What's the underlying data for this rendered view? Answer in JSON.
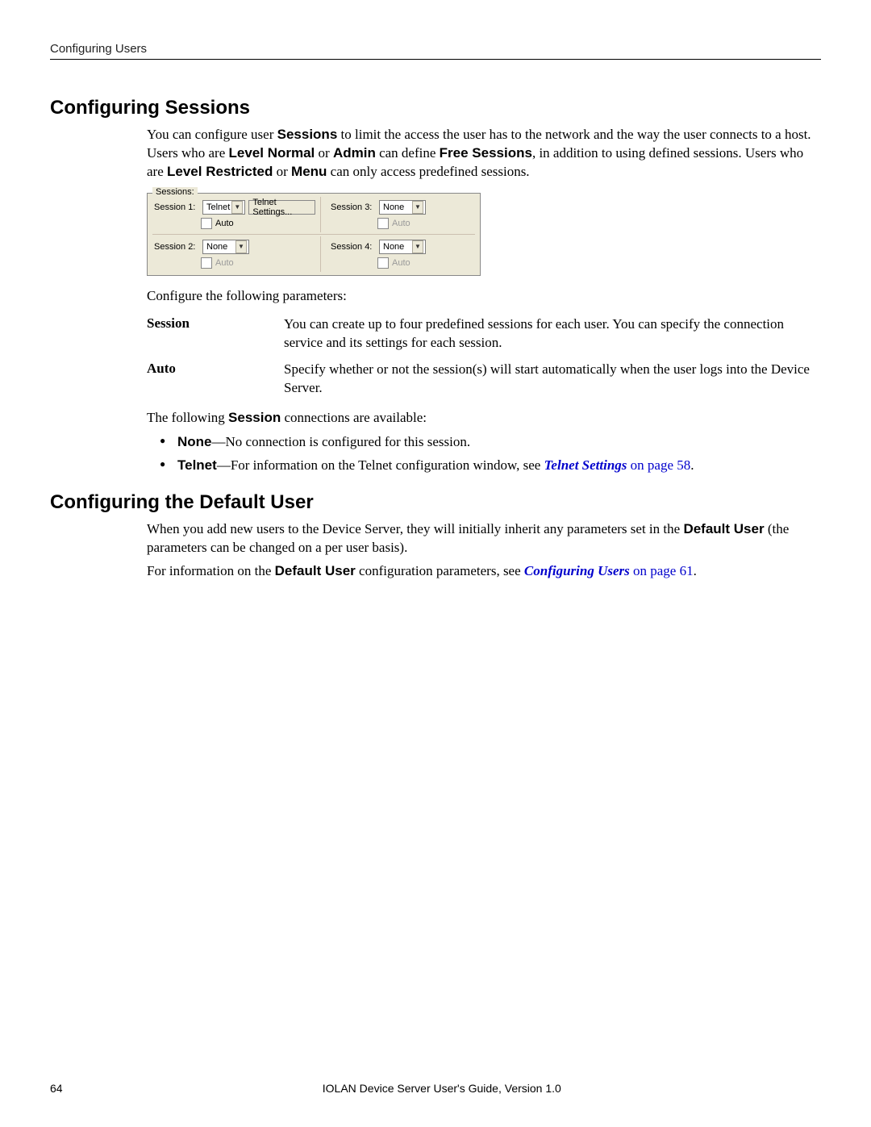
{
  "header": {
    "running_title": "Configuring Users"
  },
  "sections": {
    "sessions": {
      "heading": "Configuring Sessions",
      "intro_parts": {
        "p1a": "You can configure user ",
        "p1b": "Sessions",
        "p1c": " to limit the access the user has to the network and the way the user connects to a host. Users who are ",
        "p1d": "Level Normal",
        "p1e": " or ",
        "p1f": "Admin",
        "p1g": " can define ",
        "p1h": "Free Sessions",
        "p1i": ", in addition to using defined sessions. Users who are ",
        "p1j": "Level Restricted",
        "p1k": " or ",
        "p1l": "Menu",
        "p1m": " can only access predefined sessions."
      },
      "fieldset": {
        "legend": "Sessions:",
        "session1": {
          "label": "Session 1:",
          "select": "Telnet",
          "button": "Telnet Settings...",
          "auto_label": "Auto",
          "auto_checked": false,
          "auto_enabled": true
        },
        "session2": {
          "label": "Session 2:",
          "select": "None",
          "auto_label": "Auto",
          "auto_checked": false,
          "auto_enabled": false
        },
        "session3": {
          "label": "Session 3:",
          "select": "None",
          "auto_label": "Auto",
          "auto_checked": false,
          "auto_enabled": false
        },
        "session4": {
          "label": "Session 4:",
          "select": "None",
          "auto_label": "Auto",
          "auto_checked": false,
          "auto_enabled": false
        }
      },
      "configure_line": "Configure the following parameters:",
      "params": {
        "session": {
          "name": "Session",
          "desc": "You can create up to four predefined sessions for each user. You can specify the connection service and its settings for each session."
        },
        "auto": {
          "name": "Auto",
          "desc": "Specify whether or not the session(s) will start automatically when the user logs into the Device Server."
        }
      },
      "avail_parts": {
        "a1": "The following ",
        "a2": "Session",
        "a3": " connections are available:"
      },
      "bullets": {
        "none": {
          "b1": "None",
          "b2": "—No connection is configured for this session."
        },
        "telnet": {
          "b1": "Telnet",
          "b2": "—For information on the Telnet configuration window, see ",
          "link": "Telnet Settings",
          "after": " on page 58",
          "period": "."
        }
      }
    },
    "default_user": {
      "heading": "Configuring the Default User",
      "p1a": "When you add new users to the Device Server, they will initially inherit any parameters set in the ",
      "p1b": "Default User",
      "p1c": " (the parameters can be changed on a per user basis).",
      "p2a": "For information on the ",
      "p2b": "Default User",
      "p2c": " configuration parameters, see ",
      "link": "Configuring Users",
      "after": " on page 61",
      "period": "."
    }
  },
  "footer": {
    "page": "64",
    "doc_title": "IOLAN Device Server User's Guide, Version 1.0"
  }
}
